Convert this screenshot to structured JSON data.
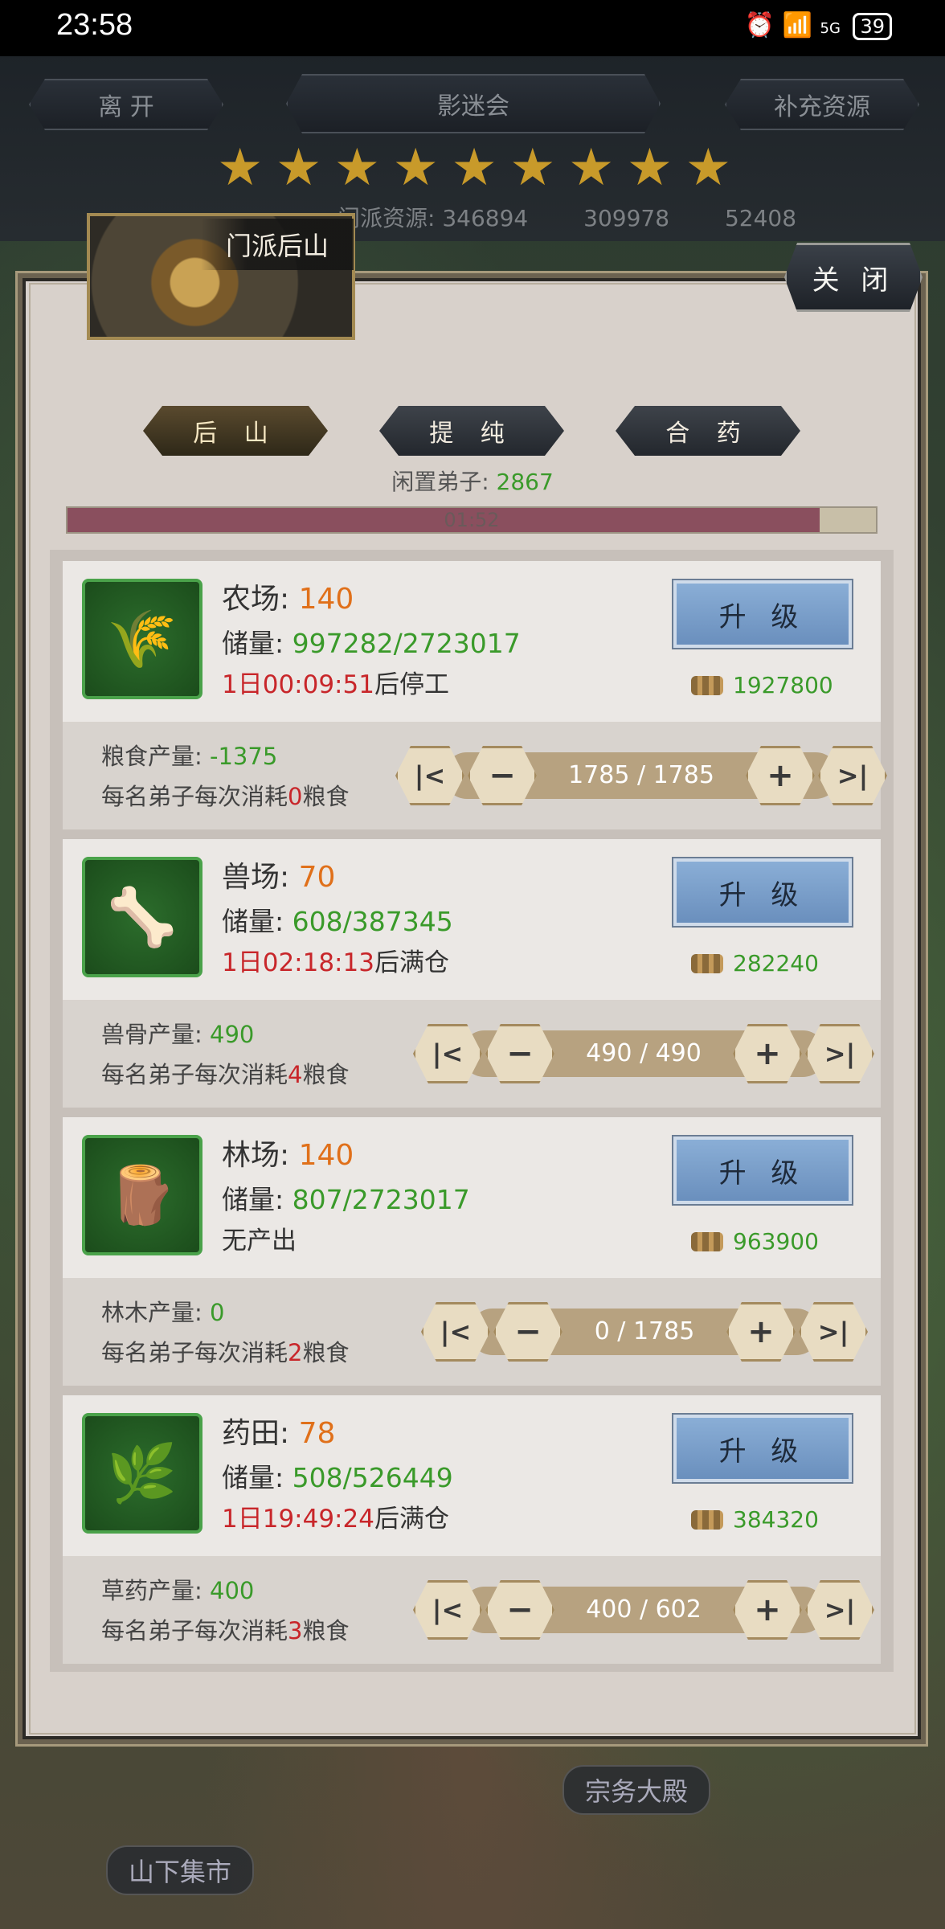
{
  "status_bar": {
    "time": "23:58",
    "battery": "39",
    "signal": "5G"
  },
  "header": {
    "leave": "离 开",
    "title": "影迷会",
    "replenish": "补充资源"
  },
  "stars": [
    "★",
    "★",
    "★",
    "★",
    "★",
    "★",
    "★",
    "★",
    "★"
  ],
  "resources": {
    "sect_label": "门派资源: 346894",
    "r2": "309978",
    "r3": "52408"
  },
  "panel": {
    "thumbnail_title": "门派后山",
    "close": "关 闭"
  },
  "tabs": [
    "后 山",
    "提 纯",
    "合 药"
  ],
  "idle": {
    "label": "闲置弟子:",
    "value": "2867"
  },
  "timer": {
    "text": "01:52",
    "fraction": 0.93
  },
  "buildings": [
    {
      "name": "农场:",
      "level": "140",
      "store_label": "储量:",
      "store": "997282/2723017",
      "timer": "1日00:09:51",
      "timer_suffix": "后停工",
      "status_plain": "",
      "upgrade": "升 级",
      "cost": "1927800",
      "prod_label": "粮食产量:",
      "prod": "-1375",
      "cons_pre": "每名弟子每次消耗",
      "cons": "0",
      "cons_post": "粮食",
      "stepper": "1785 / 1785"
    },
    {
      "name": "兽场:",
      "level": "70",
      "store_label": "储量:",
      "store": "608/387345",
      "timer": "1日02:18:13",
      "timer_suffix": "后满仓",
      "status_plain": "",
      "upgrade": "升 级",
      "cost": "282240",
      "prod_label": "兽骨产量:",
      "prod": "490",
      "cons_pre": "每名弟子每次消耗",
      "cons": "4",
      "cons_post": "粮食",
      "stepper": "490 / 490"
    },
    {
      "name": "林场:",
      "level": "140",
      "store_label": "储量:",
      "store": "807/2723017",
      "timer": "",
      "timer_suffix": "",
      "status_plain": "无产出",
      "upgrade": "升 级",
      "cost": "963900",
      "prod_label": "林木产量:",
      "prod": "0",
      "cons_pre": "每名弟子每次消耗",
      "cons": "2",
      "cons_post": "粮食",
      "stepper": "0 / 1785"
    },
    {
      "name": "药田:",
      "level": "78",
      "store_label": "储量:",
      "store": "508/526449",
      "timer": "1日19:49:24",
      "timer_suffix": "后满仓",
      "status_plain": "",
      "upgrade": "升 级",
      "cost": "384320",
      "prod_label": "草药产量:",
      "prod": "400",
      "cons_pre": "每名弟子每次消耗",
      "cons": "3",
      "cons_post": "粮食",
      "stepper": "400 / 602"
    }
  ],
  "stepper_icons": {
    "first": "|<",
    "minus": "−",
    "plus": "+",
    "last": ">|"
  },
  "scene": {
    "hall": "宗务大殿",
    "market": "山下集市"
  }
}
